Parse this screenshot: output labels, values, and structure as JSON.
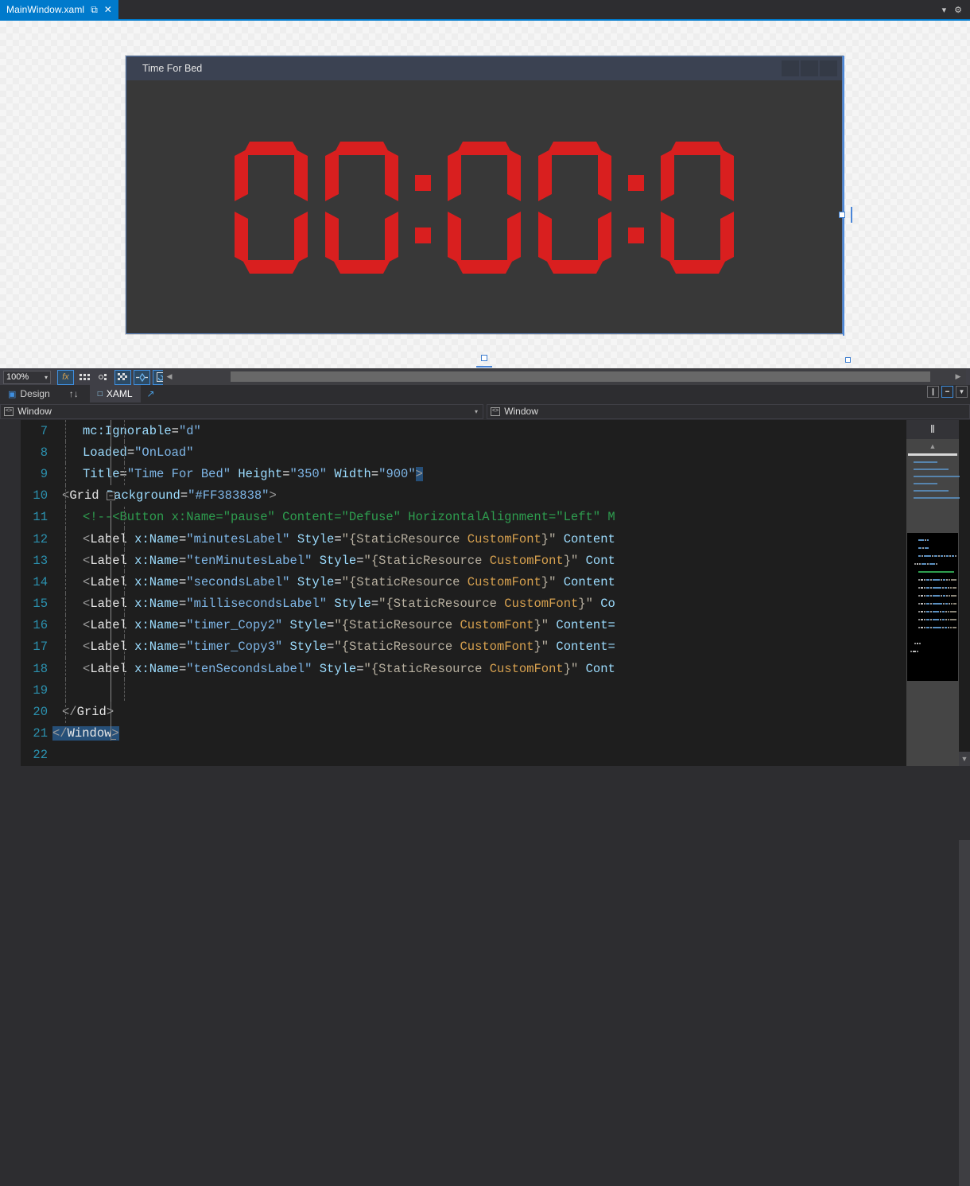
{
  "tab": {
    "label": "MainWindow.xaml",
    "pin_icon": "⧉",
    "close_icon": "✕",
    "dropdown_icon": "▾",
    "settings_icon": "⚙"
  },
  "designer": {
    "preview_title": "Time For Bed",
    "clock_display": "00:00:0",
    "clock_color": "#d91f1f",
    "background_color": "#383838",
    "window_buttons": [
      "minimize",
      "maximize",
      "close"
    ]
  },
  "zoom_toolbar": {
    "zoom_level": "100%",
    "caret_icon": "▾",
    "buttons": [
      {
        "name": "effects",
        "glyph": "fx",
        "selected": false
      },
      {
        "name": "grid-snap",
        "glyph": "▒",
        "selected": false
      },
      {
        "name": "snap-to-gridlines",
        "glyph": "░",
        "selected": false
      },
      {
        "name": "show-handles",
        "glyph": "▦",
        "selected": true
      },
      {
        "name": "snap-to-snaplines",
        "glyph": "✤",
        "selected": true
      },
      {
        "name": "enable-project-code",
        "glyph": "⧉",
        "selected": true
      }
    ],
    "scroll_left_icon": "◀",
    "scroll_right_icon": "▶"
  },
  "view_tabs": {
    "design_label": "Design",
    "design_icon": "▣",
    "swap_icon": "↑↓",
    "xaml_label": "XAML",
    "xaml_icon": "□",
    "popout_icon": "↗",
    "split_buttons": [
      {
        "name": "split-vertical",
        "glyph": "❙",
        "selected": false
      },
      {
        "name": "split-horizontal",
        "glyph": "☰",
        "selected": true
      },
      {
        "name": "collapse-pane",
        "glyph": "✕",
        "selected": false
      }
    ]
  },
  "nav_bars": {
    "left": {
      "icon": "<>",
      "label": "Window",
      "caret": "▾"
    },
    "right": {
      "icon": "<>",
      "label": "Window"
    }
  },
  "editor": {
    "lines": [
      {
        "num": "7",
        "indent": 2,
        "tokens": [
          {
            "t": "mc:Ignorable",
            "c": "t-attr"
          },
          {
            "t": "=",
            "c": "t-eq"
          },
          {
            "t": "\"d\"",
            "c": "t-str"
          }
        ]
      },
      {
        "num": "8",
        "indent": 2,
        "tokens": [
          {
            "t": "Loaded",
            "c": "t-attr"
          },
          {
            "t": "=",
            "c": "t-eq"
          },
          {
            "t": "\"OnLoad\"",
            "c": "t-str"
          }
        ]
      },
      {
        "num": "9",
        "indent": 2,
        "tokens": [
          {
            "t": "Title",
            "c": "t-attr"
          },
          {
            "t": "=",
            "c": "t-eq"
          },
          {
            "t": "\"Time For Bed\"",
            "c": "t-str"
          },
          {
            "t": " ",
            "c": "t-eq"
          },
          {
            "t": "Height",
            "c": "t-attr"
          },
          {
            "t": "=",
            "c": "t-eq"
          },
          {
            "t": "\"350\"",
            "c": "t-str"
          },
          {
            "t": " ",
            "c": "t-eq"
          },
          {
            "t": "Width",
            "c": "t-attr"
          },
          {
            "t": "=",
            "c": "t-eq"
          },
          {
            "t": "\"900\"",
            "c": "t-str"
          },
          {
            "t": ">",
            "c": "t-punct t-sel"
          }
        ]
      },
      {
        "num": "10",
        "indent": 1,
        "tokens": [
          {
            "t": "<",
            "c": "t-punct"
          },
          {
            "t": "Grid",
            "c": "t-tag"
          },
          {
            "t": " ",
            "c": "t-eq"
          },
          {
            "t": "Background",
            "c": "t-attr"
          },
          {
            "t": "=",
            "c": "t-eq"
          },
          {
            "t": "\"#FF383838\"",
            "c": "t-str"
          },
          {
            "t": ">",
            "c": "t-punct"
          }
        ]
      },
      {
        "num": "11",
        "indent": 2,
        "tokens": [
          {
            "t": "<!--<Button x:Name=\"pause\" Content=\"Defuse\" HorizontalAlignment=\"Left\" M",
            "c": "t-cmt"
          }
        ]
      },
      {
        "num": "12",
        "indent": 2,
        "tokens": [
          {
            "t": "<",
            "c": "t-punct"
          },
          {
            "t": "Label",
            "c": "t-tag"
          },
          {
            "t": " ",
            "c": "t-eq"
          },
          {
            "t": "x:Name",
            "c": "t-attr"
          },
          {
            "t": "=",
            "c": "t-eq"
          },
          {
            "t": "\"minutesLabel\"",
            "c": "t-str"
          },
          {
            "t": " ",
            "c": "t-eq"
          },
          {
            "t": "Style",
            "c": "t-attr"
          },
          {
            "t": "=",
            "c": "t-eq"
          },
          {
            "t": "\"{",
            "c": "t-res"
          },
          {
            "t": "StaticResource ",
            "c": "t-res"
          },
          {
            "t": "CustomFont",
            "c": "t-resval"
          },
          {
            "t": "}\"",
            "c": "t-res"
          },
          {
            "t": " ",
            "c": "t-eq"
          },
          {
            "t": "Content",
            "c": "t-attr"
          }
        ]
      },
      {
        "num": "13",
        "indent": 2,
        "tokens": [
          {
            "t": "<",
            "c": "t-punct"
          },
          {
            "t": "Label",
            "c": "t-tag"
          },
          {
            "t": " ",
            "c": "t-eq"
          },
          {
            "t": "x:Name",
            "c": "t-attr"
          },
          {
            "t": "=",
            "c": "t-eq"
          },
          {
            "t": "\"tenMinutesLabel\"",
            "c": "t-str"
          },
          {
            "t": " ",
            "c": "t-eq"
          },
          {
            "t": "Style",
            "c": "t-attr"
          },
          {
            "t": "=",
            "c": "t-eq"
          },
          {
            "t": "\"{",
            "c": "t-res"
          },
          {
            "t": "StaticResource ",
            "c": "t-res"
          },
          {
            "t": "CustomFont",
            "c": "t-resval"
          },
          {
            "t": "}\"",
            "c": "t-res"
          },
          {
            "t": " ",
            "c": "t-eq"
          },
          {
            "t": "Cont",
            "c": "t-attr"
          }
        ]
      },
      {
        "num": "14",
        "indent": 2,
        "tokens": [
          {
            "t": "<",
            "c": "t-punct"
          },
          {
            "t": "Label",
            "c": "t-tag"
          },
          {
            "t": " ",
            "c": "t-eq"
          },
          {
            "t": "x:Name",
            "c": "t-attr"
          },
          {
            "t": "=",
            "c": "t-eq"
          },
          {
            "t": "\"secondsLabel\"",
            "c": "t-str"
          },
          {
            "t": " ",
            "c": "t-eq"
          },
          {
            "t": "Style",
            "c": "t-attr"
          },
          {
            "t": "=",
            "c": "t-eq"
          },
          {
            "t": "\"{",
            "c": "t-res"
          },
          {
            "t": "StaticResource ",
            "c": "t-res"
          },
          {
            "t": "CustomFont",
            "c": "t-resval"
          },
          {
            "t": "}\"",
            "c": "t-res"
          },
          {
            "t": " ",
            "c": "t-eq"
          },
          {
            "t": "Content",
            "c": "t-attr"
          }
        ]
      },
      {
        "num": "15",
        "indent": 2,
        "tokens": [
          {
            "t": "<",
            "c": "t-punct"
          },
          {
            "t": "Label",
            "c": "t-tag"
          },
          {
            "t": " ",
            "c": "t-eq"
          },
          {
            "t": "x:Name",
            "c": "t-attr"
          },
          {
            "t": "=",
            "c": "t-eq"
          },
          {
            "t": "\"millisecondsLabel\"",
            "c": "t-str"
          },
          {
            "t": " ",
            "c": "t-eq"
          },
          {
            "t": "Style",
            "c": "t-attr"
          },
          {
            "t": "=",
            "c": "t-eq"
          },
          {
            "t": "\"{",
            "c": "t-res"
          },
          {
            "t": "StaticResource ",
            "c": "t-res"
          },
          {
            "t": "CustomFont",
            "c": "t-resval"
          },
          {
            "t": "}\"",
            "c": "t-res"
          },
          {
            "t": " ",
            "c": "t-eq"
          },
          {
            "t": "Co",
            "c": "t-attr"
          }
        ]
      },
      {
        "num": "16",
        "indent": 2,
        "tokens": [
          {
            "t": "<",
            "c": "t-punct"
          },
          {
            "t": "Label",
            "c": "t-tag"
          },
          {
            "t": " ",
            "c": "t-eq"
          },
          {
            "t": "x:Name",
            "c": "t-attr"
          },
          {
            "t": "=",
            "c": "t-eq"
          },
          {
            "t": "\"timer_Copy2\"",
            "c": "t-str"
          },
          {
            "t": " ",
            "c": "t-eq"
          },
          {
            "t": "Style",
            "c": "t-attr"
          },
          {
            "t": "=",
            "c": "t-eq"
          },
          {
            "t": "\"{",
            "c": "t-res"
          },
          {
            "t": "StaticResource ",
            "c": "t-res"
          },
          {
            "t": "CustomFont",
            "c": "t-resval"
          },
          {
            "t": "}\"",
            "c": "t-res"
          },
          {
            "t": " ",
            "c": "t-eq"
          },
          {
            "t": "Content=",
            "c": "t-attr"
          }
        ]
      },
      {
        "num": "17",
        "indent": 2,
        "tokens": [
          {
            "t": "<",
            "c": "t-punct"
          },
          {
            "t": "Label",
            "c": "t-tag"
          },
          {
            "t": " ",
            "c": "t-eq"
          },
          {
            "t": "x:Name",
            "c": "t-attr"
          },
          {
            "t": "=",
            "c": "t-eq"
          },
          {
            "t": "\"timer_Copy3\"",
            "c": "t-str"
          },
          {
            "t": " ",
            "c": "t-eq"
          },
          {
            "t": "Style",
            "c": "t-attr"
          },
          {
            "t": "=",
            "c": "t-eq"
          },
          {
            "t": "\"{",
            "c": "t-res"
          },
          {
            "t": "StaticResource ",
            "c": "t-res"
          },
          {
            "t": "CustomFont",
            "c": "t-resval"
          },
          {
            "t": "}\"",
            "c": "t-res"
          },
          {
            "t": " ",
            "c": "t-eq"
          },
          {
            "t": "Content=",
            "c": "t-attr"
          }
        ]
      },
      {
        "num": "18",
        "indent": 2,
        "tokens": [
          {
            "t": "<",
            "c": "t-punct"
          },
          {
            "t": "Label",
            "c": "t-tag"
          },
          {
            "t": " ",
            "c": "t-eq"
          },
          {
            "t": "x:Name",
            "c": "t-attr"
          },
          {
            "t": "=",
            "c": "t-eq"
          },
          {
            "t": "\"tenSecondsLabel\"",
            "c": "t-str"
          },
          {
            "t": " ",
            "c": "t-eq"
          },
          {
            "t": "Style",
            "c": "t-attr"
          },
          {
            "t": "=",
            "c": "t-eq"
          },
          {
            "t": "\"{",
            "c": "t-res"
          },
          {
            "t": "StaticResource ",
            "c": "t-res"
          },
          {
            "t": "CustomFont",
            "c": "t-resval"
          },
          {
            "t": "}\"",
            "c": "t-res"
          },
          {
            "t": " ",
            "c": "t-eq"
          },
          {
            "t": "Cont",
            "c": "t-attr"
          }
        ]
      },
      {
        "num": "19",
        "indent": 2,
        "tokens": []
      },
      {
        "num": "20",
        "indent": 1,
        "tokens": [
          {
            "t": "</",
            "c": "t-punct"
          },
          {
            "t": "Grid",
            "c": "t-tag"
          },
          {
            "t": ">",
            "c": "t-punct"
          }
        ]
      },
      {
        "num": "21",
        "indent": 0,
        "tokens": [
          {
            "t": "</",
            "c": "t-punct t-sel"
          },
          {
            "t": "Window",
            "c": "t-tag t-sel"
          },
          {
            "t": ">",
            "c": "t-punct t-sel"
          }
        ]
      },
      {
        "num": "22",
        "indent": 0,
        "tokens": []
      }
    ]
  },
  "minimap": {
    "split_icon": "⫴",
    "up_icon": "▲",
    "down_icon": "▼"
  }
}
